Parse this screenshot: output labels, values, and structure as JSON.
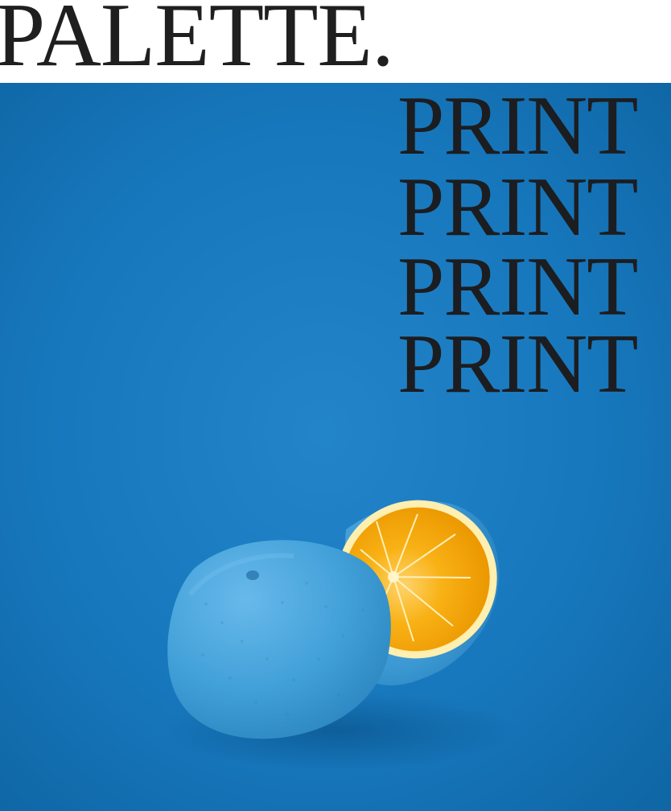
{
  "brand": {
    "title": "PALETTE."
  },
  "hero": {
    "lines": [
      "PRINT",
      "PRINT",
      "PRINT",
      "PRINT"
    ]
  },
  "colors": {
    "background": "#1777bc",
    "text": "#1c1d20",
    "orange_flesh": "#f6a500",
    "blue_skin": "#4aa8dc"
  }
}
